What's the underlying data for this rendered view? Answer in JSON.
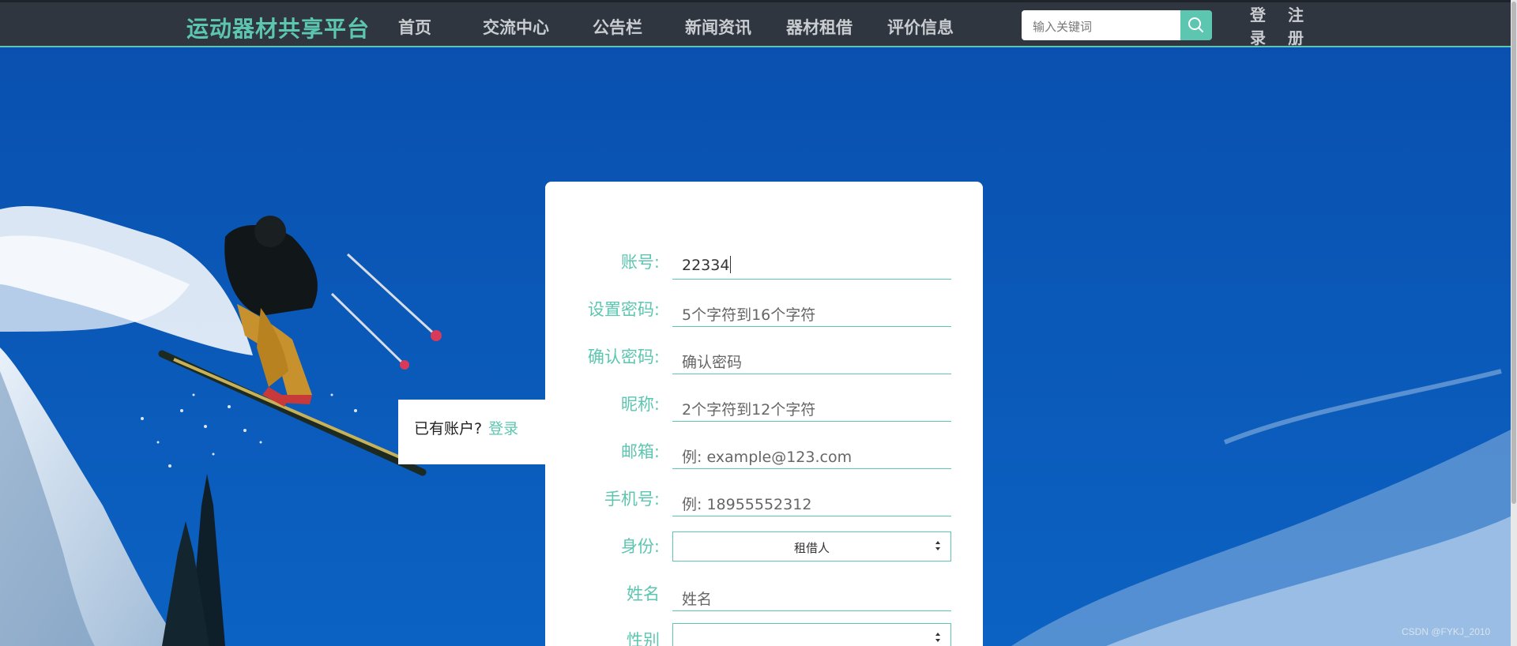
{
  "nav": {
    "brand": "运动器材共享平台",
    "items": [
      "首页",
      "交流中心",
      "公告栏",
      "新闻资讯",
      "器材租借",
      "评价信息"
    ],
    "search_placeholder": "输入关键词",
    "login_label": [
      "登",
      "录"
    ],
    "register_label": [
      "注",
      "册"
    ],
    "search_icon": "search-icon"
  },
  "form": {
    "account": {
      "label": "账号:",
      "value": "22334"
    },
    "password": {
      "label": "设置密码:",
      "placeholder": "5个字符到16个字符"
    },
    "confirm": {
      "label": "确认密码:",
      "placeholder": "确认密码"
    },
    "nickname": {
      "label": "昵称:",
      "placeholder": "2个字符到12个字符"
    },
    "email": {
      "label": "邮箱:",
      "placeholder": "例: example@123.com"
    },
    "phone": {
      "label": "手机号:",
      "placeholder": "例: 18955552312"
    },
    "identity": {
      "label": "身份:",
      "selected": "租借人"
    },
    "name": {
      "label": "姓名",
      "placeholder": "姓名"
    },
    "gender": {
      "label": "性别",
      "selected": ""
    }
  },
  "login_tip": {
    "text": "已有账户?",
    "link": "登录"
  },
  "watermark": "CSDN @FYKJ_2010",
  "colors": {
    "accent": "#5cc6b0",
    "navbar": "#2f3640",
    "sky": "#0a56b0"
  }
}
